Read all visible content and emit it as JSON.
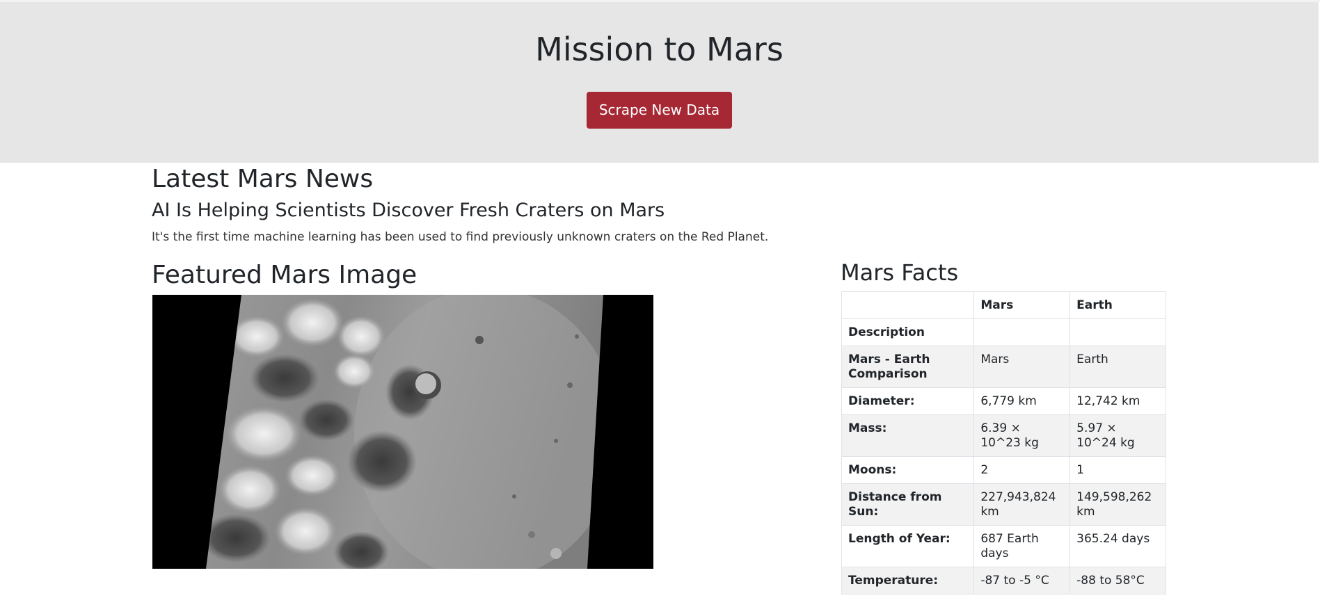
{
  "header": {
    "title": "Mission to Mars",
    "scrape_button_label": "Scrape New Data"
  },
  "news": {
    "section_heading": "Latest Mars News",
    "title": "AI Is Helping Scientists Discover Fresh Craters on Mars",
    "teaser": "It's the first time machine learning has been used to find previously unknown craters on the Red Planet."
  },
  "featured_image": {
    "section_heading": "Featured Mars Image"
  },
  "facts": {
    "section_heading": "Mars Facts",
    "columns": [
      "",
      "Mars",
      "Earth"
    ],
    "rows": [
      {
        "label": "Description",
        "mars": "",
        "earth": ""
      },
      {
        "label": "Mars - Earth Comparison",
        "mars": "Mars",
        "earth": "Earth"
      },
      {
        "label": "Diameter:",
        "mars": "6,779 km",
        "earth": "12,742 km"
      },
      {
        "label": "Mass:",
        "mars": "6.39 × 10^23 kg",
        "earth": "5.97 × 10^24 kg"
      },
      {
        "label": "Moons:",
        "mars": "2",
        "earth": "1"
      },
      {
        "label": "Distance from Sun:",
        "mars": "227,943,824 km",
        "earth": "149,598,262 km"
      },
      {
        "label": "Length of Year:",
        "mars": "687 Earth days",
        "earth": "365.24 days"
      },
      {
        "label": "Temperature:",
        "mars": "-87 to -5 °C",
        "earth": "-88 to 58°C"
      }
    ]
  },
  "colors": {
    "jumbotron_bg": "#e6e6e6",
    "button_bg": "#a52834",
    "text": "#212529"
  }
}
